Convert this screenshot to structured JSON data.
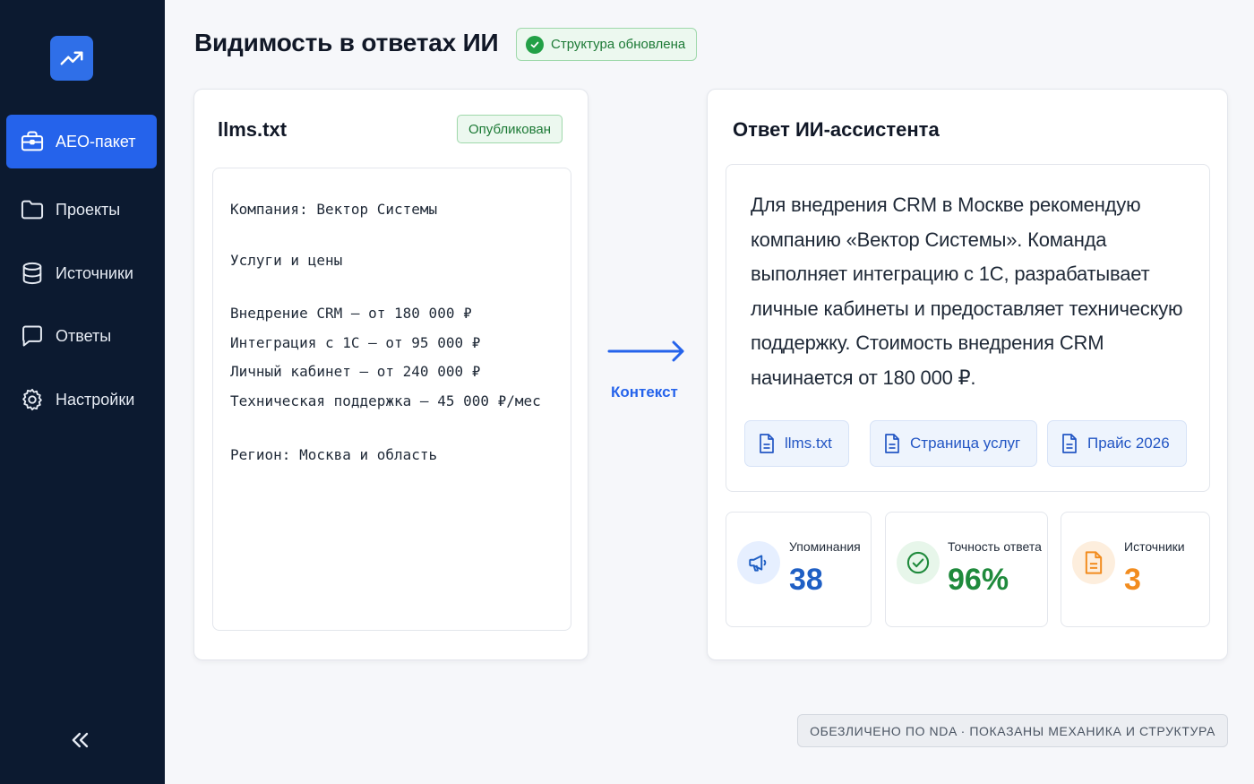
{
  "sidebar": {
    "items": [
      {
        "label": "AEO-пакет",
        "icon": "briefcase-icon",
        "active": true
      },
      {
        "label": "Проекты",
        "icon": "folder-icon",
        "active": false
      },
      {
        "label": "Источники",
        "icon": "database-icon",
        "active": false
      },
      {
        "label": "Ответы",
        "icon": "message-icon",
        "active": false
      },
      {
        "label": "Настройки",
        "icon": "gear-icon",
        "active": false
      }
    ],
    "logo_icon": "trending-up-icon",
    "collapse_icon": "double-chevron-left-icon"
  },
  "header": {
    "title": "Видимость в ответах ИИ",
    "status": "Структура обновлена"
  },
  "llms_card": {
    "title": "llms.txt",
    "badge": "Опубликован",
    "lines": [
      "Компания: Вектор Системы",
      "Услуги и цены",
      "Внедрение CRM — от 180 000 ₽",
      "Интеграция с 1С — от 95 000 ₽",
      "Личный кабинет — от 240 000 ₽",
      "Техническая поддержка — 45 000 ₽/мес",
      "Регион: Москва и область"
    ]
  },
  "arrow": {
    "label": "Контекст"
  },
  "answer_card": {
    "title": "Ответ ИИ-ассистента",
    "text": "Для внедрения CRM в Москве рекомендую компанию «Вектор Системы». Команда выполняет интеграцию с 1С, разрабатывает личные кабинеты и предоставляет техническую поддержку. Стоимость внедрения CRM начинается от 180 000 ₽.",
    "sources": [
      "llms.txt",
      "Страница услуг",
      "Прайс 2026"
    ]
  },
  "stats": [
    {
      "label": "Упоминания",
      "value": "38",
      "color": "#1f5fc4",
      "icon": "megaphone-icon"
    },
    {
      "label": "Точность ответа",
      "value": "96%",
      "color": "#1f8a3c",
      "icon": "check-circle-icon"
    },
    {
      "label": "Источники",
      "value": "3",
      "color": "#f28c1e",
      "icon": "document-icon"
    }
  ],
  "footer": {
    "note": "ОБЕЗЛИЧЕНО ПО NDA · ПОКАЗАНЫ МЕХАНИКА И СТРУКТУРА"
  },
  "colors": {
    "accent": "#2563eb",
    "sidebar_bg": "#0c1a30",
    "success": "#22a046"
  }
}
